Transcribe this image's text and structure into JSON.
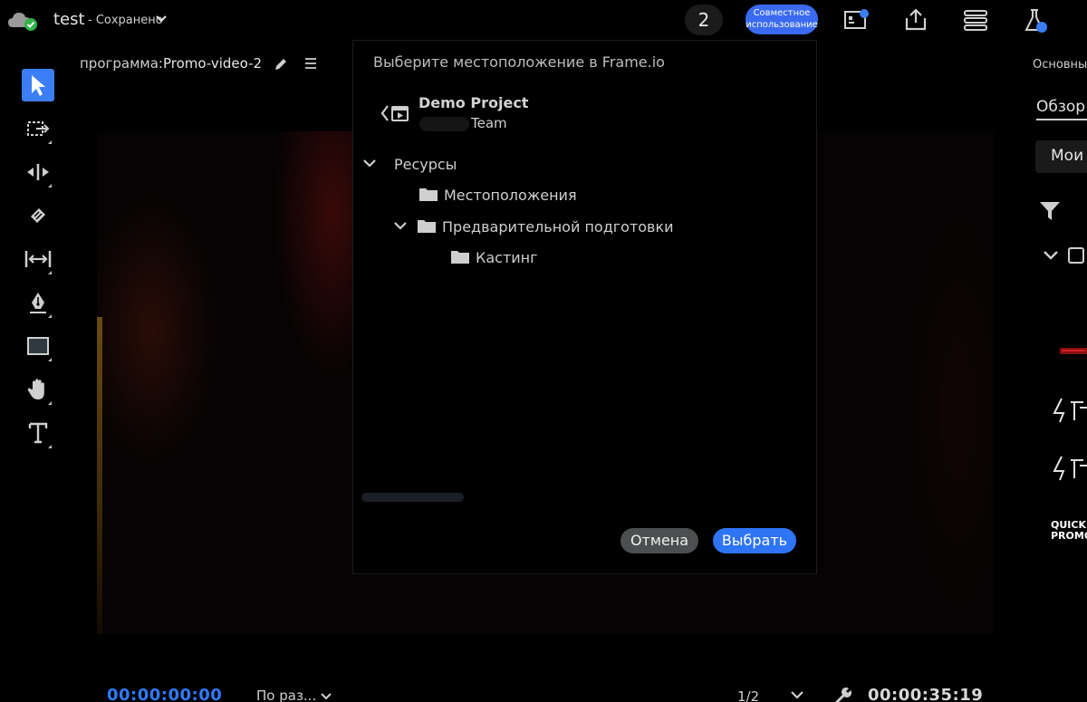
{
  "topbar": {
    "title": "test",
    "status": "- Сохранено",
    "collab_count": "2",
    "share_label_line1": "Совместное",
    "share_label_line2": "использование"
  },
  "monitor": {
    "sequence_prefix": "программа:",
    "sequence_name": "Promo-video-2"
  },
  "footer": {
    "timecode_current": "00:00:00:00",
    "fit_label": "По раз...",
    "page_indicator": "1/2",
    "timecode_total": "00:00:35:19"
  },
  "right_panel": {
    "header": "Основны",
    "tab": "Обзор",
    "select": "Мои",
    "thumb_text_1": "QUICK",
    "thumb_text_2": "PROMO"
  },
  "modal": {
    "title": "Выберите местоположение в Frame.io",
    "project_name": "Demo Project",
    "team_name": "Team",
    "tree": [
      {
        "label": "Ресурсы",
        "expanded": true
      },
      {
        "label": "Местоположения"
      },
      {
        "label": "Предварительной подготовки",
        "expanded": true
      },
      {
        "label": "Кастинг"
      }
    ],
    "cancel_label": "Отмена",
    "select_label": "Выбрать"
  },
  "colors": {
    "accent": "#3b7ef5",
    "timecode": "#2f7bff",
    "background": "#000000"
  }
}
